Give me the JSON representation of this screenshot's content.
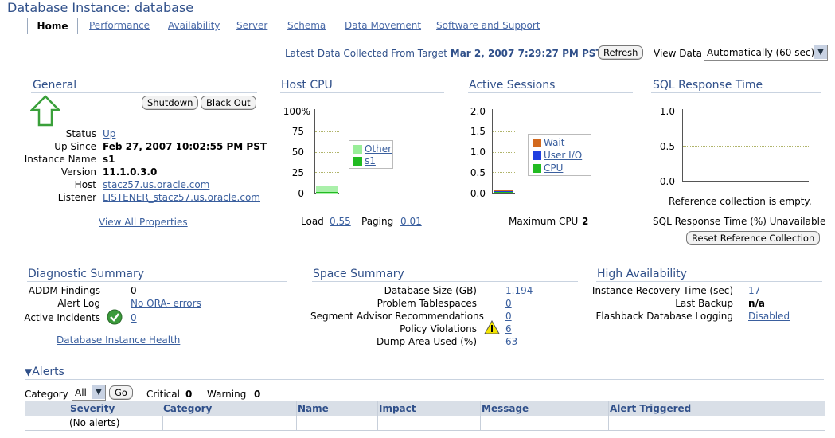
{
  "page": {
    "title": "Database Instance: database"
  },
  "tabs": [
    "Home",
    "Performance",
    "Availability",
    "Server",
    "Schema",
    "Data Movement",
    "Software and Support"
  ],
  "collect": {
    "label": "Latest Data Collected From Target",
    "datetime": "Mar 2, 2007 7:29:27 PM PST",
    "refresh": "Refresh",
    "view_label": "View Data",
    "view_value": "Automatically (60 sec)"
  },
  "general": {
    "title": "General",
    "shutdown": "Shutdown",
    "blackout": "Black Out",
    "rows": [
      {
        "label": "Status",
        "value": "Up"
      },
      {
        "label": "Up Since",
        "value": "Feb 27, 2007 10:02:55 PM PST"
      },
      {
        "label": "Instance Name",
        "value": "s1"
      },
      {
        "label": "Version",
        "value": "11.1.0.3.0"
      },
      {
        "label": "Host",
        "value": "stacz57.us.oracle.com"
      },
      {
        "label": "Listener",
        "value": "LISTENER_stacz57.us.oracle.com"
      }
    ],
    "view_all": "View All Properties",
    "status_icon": "up-arrow-icon"
  },
  "host_cpu": {
    "title": "Host CPU",
    "ticks": [
      "100%",
      "75",
      "50",
      "25",
      "0"
    ],
    "legend": [
      {
        "name": "Other",
        "color": "#99ee99"
      },
      {
        "name": "s1",
        "color": "#22bb22"
      }
    ],
    "load_label": "Load",
    "load_value": "0.55",
    "paging_label": "Paging",
    "paging_value": "0.01"
  },
  "active_sessions": {
    "title": "Active Sessions",
    "ticks": [
      "2.0",
      "1.5",
      "1.0",
      "0.5",
      "0.0"
    ],
    "legend": [
      {
        "name": "Wait",
        "color": "#d2691e"
      },
      {
        "name": "User I/O",
        "color": "#1f3fe0"
      },
      {
        "name": "CPU",
        "color": "#22bb22"
      }
    ],
    "max_cpu_label": "Maximum CPU",
    "max_cpu_value": "2"
  },
  "sql_response": {
    "title": "SQL Response Time",
    "ticks": [
      "1.0",
      "0.5",
      "0.0"
    ],
    "empty_msg": "Reference collection is empty.",
    "status": "SQL Response Time (%) Unavailable",
    "reset": "Reset Reference Collection"
  },
  "diagnostic": {
    "title": "Diagnostic Summary",
    "addm_label": "ADDM Findings",
    "addm_value": "0",
    "alert_label": "Alert Log",
    "alert_value": "No ORA- errors",
    "incidents_label": "Active Incidents",
    "incidents_value": "0",
    "health_link": "Database Instance Health",
    "ok_icon": "check-icon"
  },
  "space": {
    "title": "Space Summary",
    "rows": [
      {
        "label": "Database Size (GB)",
        "value": "1.194"
      },
      {
        "label": "Problem Tablespaces",
        "value": "0"
      },
      {
        "label": "Segment Advisor Recommendations",
        "value": "0"
      },
      {
        "label": "Policy Violations",
        "value": "6"
      },
      {
        "label": "Dump Area Used (%)",
        "value": "63"
      }
    ],
    "warn_icon": "warning-icon"
  },
  "ha": {
    "title": "High Availability",
    "recovery_label": "Instance Recovery Time (sec)",
    "recovery_value": "17",
    "backup_label": "Last Backup",
    "backup_value": "n/a",
    "flashback_label": "Flashback Database Logging",
    "flashback_value": "Disabled"
  },
  "alerts": {
    "title": "Alerts",
    "category_label": "Category",
    "category_value": "All",
    "go": "Go",
    "critical_label": "Critical",
    "critical_value": "0",
    "warning_label": "Warning",
    "warning_value": "0",
    "columns": [
      "Severity",
      "Category",
      "Name",
      "Impact",
      "Message",
      "Alert Triggered"
    ],
    "empty": "(No alerts)"
  }
}
